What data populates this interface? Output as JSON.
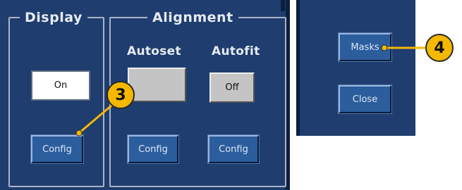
{
  "display": {
    "legend": "Display",
    "state_value": "On",
    "config_label": "Config"
  },
  "alignment": {
    "legend": "Alignment",
    "autoset_label": "Autoset",
    "autofit_label": "Autofit",
    "autoset_button": "",
    "autofit_value": "Off",
    "autoset_config_label": "Config",
    "autofit_config_label": "Config"
  },
  "side_menu": {
    "masks_label": "Masks",
    "close_label": "Close"
  },
  "callouts": {
    "left": "3",
    "right": "4"
  },
  "colors": {
    "panel": "#1f3d6e",
    "button": "#2c5d9c",
    "callout": "#f5b800"
  }
}
